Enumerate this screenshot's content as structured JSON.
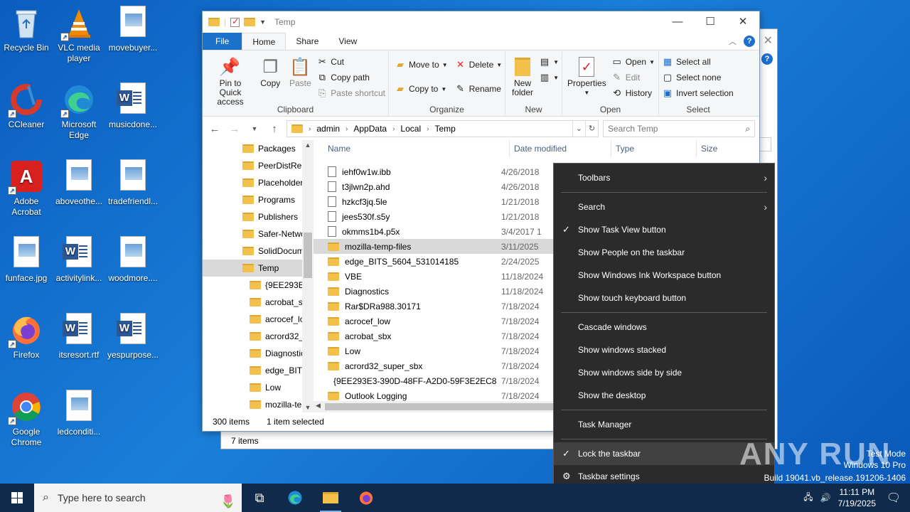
{
  "desktop": {
    "icons": [
      {
        "label": "Recycle Bin"
      },
      {
        "label": "VLC media player"
      },
      {
        "label": "movebuyer..."
      },
      {
        "label": "CCleaner"
      },
      {
        "label": "Microsoft Edge"
      },
      {
        "label": "musicdone..."
      },
      {
        "label": "Adobe Acrobat"
      },
      {
        "label": "aboveothe..."
      },
      {
        "label": "tradefriendl..."
      },
      {
        "label": "funface.jpg"
      },
      {
        "label": "activitylink..."
      },
      {
        "label": "woodmore...."
      },
      {
        "label": "Firefox"
      },
      {
        "label": "itsresort.rtf"
      },
      {
        "label": "yespurpose..."
      },
      {
        "label": "Google Chrome"
      },
      {
        "label": "ledconditi..."
      }
    ]
  },
  "back_window": {
    "status": "7 items"
  },
  "explorer": {
    "title": "Temp",
    "tabs": {
      "file": "File",
      "home": "Home",
      "share": "Share",
      "view": "View"
    },
    "ribbon": {
      "clipboard": {
        "label": "Clipboard",
        "pin": "Pin to Quick access",
        "copy": "Copy",
        "paste": "Paste",
        "cut": "Cut",
        "copy_path": "Copy path",
        "paste_shortcut": "Paste shortcut"
      },
      "organize": {
        "label": "Organize",
        "move_to": "Move to",
        "copy_to": "Copy to",
        "delete": "Delete",
        "rename": "Rename"
      },
      "new": {
        "label": "New",
        "new_folder": "New folder"
      },
      "open": {
        "label": "Open",
        "properties": "Properties",
        "open": "Open",
        "edit": "Edit",
        "history": "History"
      },
      "select": {
        "label": "Select",
        "select_all": "Select all",
        "select_none": "Select none",
        "invert": "Invert selection"
      }
    },
    "address": {
      "crumbs": [
        "admin",
        "AppData",
        "Local",
        "Temp"
      ],
      "search_placeholder": "Search Temp"
    },
    "nav": [
      {
        "label": "Packages"
      },
      {
        "label": "PeerDistRep"
      },
      {
        "label": "Placeholder"
      },
      {
        "label": "Programs"
      },
      {
        "label": "Publishers"
      },
      {
        "label": "Safer-Netwo"
      },
      {
        "label": "SolidDocum"
      },
      {
        "label": "Temp"
      },
      {
        "label": "{9EE293E3-"
      },
      {
        "label": "acrobat_sb"
      },
      {
        "label": "acrocef_lo"
      },
      {
        "label": "acrord32_s"
      },
      {
        "label": "Diagnostic"
      },
      {
        "label": "edge_BITS_"
      },
      {
        "label": "Low"
      },
      {
        "label": "mozilla-te"
      }
    ],
    "columns": {
      "name": "Name",
      "date": "Date modified",
      "type": "Type",
      "size": "Size"
    },
    "files": [
      {
        "name": "iehf0w1w.ibb",
        "date": "4/26/2018",
        "kind": "file"
      },
      {
        "name": "t3jlwn2p.ahd",
        "date": "4/26/2018",
        "kind": "file"
      },
      {
        "name": "hzkcf3jq.5le",
        "date": "1/21/2018",
        "kind": "file"
      },
      {
        "name": "jees530f.s5y",
        "date": "1/21/2018",
        "kind": "file"
      },
      {
        "name": "okmms1b4.p5x",
        "date": "3/4/2017 1",
        "kind": "file"
      },
      {
        "name": "mozilla-temp-files",
        "date": "3/11/2025",
        "kind": "folder"
      },
      {
        "name": "edge_BITS_5604_531014185",
        "date": "2/24/2025",
        "kind": "folder"
      },
      {
        "name": "VBE",
        "date": "11/18/2024",
        "kind": "folder"
      },
      {
        "name": "Diagnostics",
        "date": "11/18/2024",
        "kind": "folder"
      },
      {
        "name": "Rar$DRa988.30171",
        "date": "7/18/2024",
        "kind": "folder"
      },
      {
        "name": "acrocef_low",
        "date": "7/18/2024",
        "kind": "folder"
      },
      {
        "name": "acrobat_sbx",
        "date": "7/18/2024",
        "kind": "folder"
      },
      {
        "name": "Low",
        "date": "7/18/2024",
        "kind": "folder"
      },
      {
        "name": "acrord32_super_sbx",
        "date": "7/18/2024",
        "kind": "folder"
      },
      {
        "name": "{9EE293E3-390D-48FF-A2D0-59F3E2EC88...",
        "date": "7/18/2024",
        "kind": "folder"
      },
      {
        "name": "Outlook Logging",
        "date": "7/18/2024",
        "kind": "folder"
      }
    ],
    "status": {
      "count": "300 items",
      "selected": "1 item selected"
    }
  },
  "context_menu": {
    "toolbars": "Toolbars",
    "search": "Search",
    "task_view": "Show Task View button",
    "people": "Show People on the taskbar",
    "ink": "Show Windows Ink Workspace button",
    "touch_kb": "Show touch keyboard button",
    "cascade": "Cascade windows",
    "stacked": "Show windows stacked",
    "side_by_side": "Show windows side by side",
    "desktop": "Show the desktop",
    "task_manager": "Task Manager",
    "lock": "Lock the taskbar",
    "settings": "Taskbar settings"
  },
  "watermark": {
    "brand": "ANY RUN",
    "mode": "Test Mode",
    "os": "Windows 10 Pro",
    "build": "Build 19041.vb_release.191206-1406"
  },
  "taskbar": {
    "search_placeholder": "Type here to search",
    "time": "11:11 PM",
    "date": "7/19/2025"
  }
}
